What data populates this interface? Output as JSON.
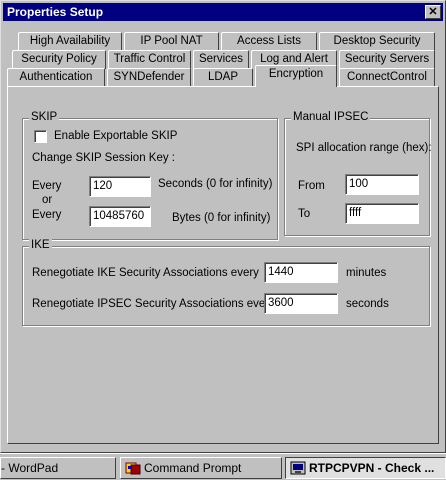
{
  "window": {
    "title": "Properties Setup",
    "close_glyph": "✕"
  },
  "tabs": {
    "row1": [
      "High Availability",
      "IP Pool NAT",
      "Access Lists",
      "Desktop Security"
    ],
    "row2": [
      "Security Policy",
      "Traffic Control",
      "Services",
      "Log and Alert",
      "Security Servers"
    ],
    "row3": [
      "Authentication",
      "SYNDefender",
      "LDAP",
      "Encryption",
      "ConnectControl"
    ],
    "active": "Encryption"
  },
  "skip": {
    "legend": "SKIP",
    "exportable_label": "Enable Exportable SKIP",
    "exportable_checked": false,
    "change_key_label": "Change SKIP Session Key :",
    "every1_label": "Every",
    "every1_value": "120",
    "every1_unit": "Seconds (0 for infinity)",
    "or_label": "or",
    "every2_label": "Every",
    "every2_value": "10485760",
    "every2_unit": "Bytes (0 for infinity)"
  },
  "ipsec": {
    "legend": "Manual IPSEC",
    "spi_label": "SPI allocation range (hex):",
    "from_label": "From",
    "from_value": "100",
    "to_label": "To",
    "to_value": "ffff"
  },
  "ike": {
    "legend": "IKE",
    "ike_label": "Renegotiate IKE Security Associations every",
    "ike_value": "1440",
    "ike_unit": "minutes",
    "ipsec_label": "Renegotiate IPSEC Security Associations every",
    "ipsec_value": "3600",
    "ipsec_unit": "seconds"
  },
  "taskbar": {
    "items": [
      "- WordPad",
      "Command Prompt",
      "RTPCPVPN - Check ..."
    ],
    "icons": [
      "wordpad-icon",
      "command-prompt-icon",
      "checkpoint-icon"
    ]
  }
}
